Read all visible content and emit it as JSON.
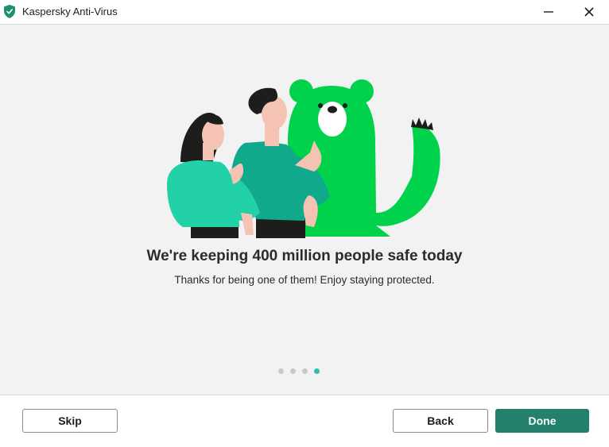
{
  "window": {
    "title": "Kaspersky Anti-Virus",
    "icon": "kaspersky-shield-icon",
    "controls": [
      "minimize-icon",
      "close-icon"
    ]
  },
  "content": {
    "illustration": "people-and-green-bear-illustration",
    "headline": "We're keeping 400 million people safe today",
    "subtext": "Thanks for being one of them! Enjoy staying protected."
  },
  "pagination": {
    "total_steps": 4,
    "current_step": 4
  },
  "footer": {
    "skip_label": "Skip",
    "back_label": "Back",
    "done_label": "Done"
  },
  "colors": {
    "brand_green": "#00d34b",
    "teal": "#23d1a8",
    "primary_button": "#23806a",
    "active_dot": "#2ebfa5"
  }
}
